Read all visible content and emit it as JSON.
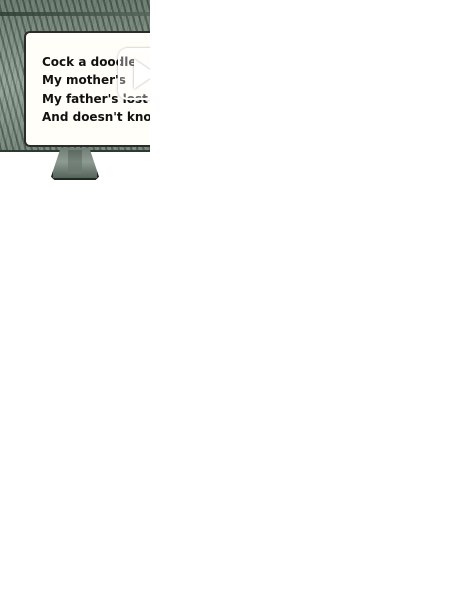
{
  "illustration": {
    "verse_lines": [
      "Cock a doodle",
      "My mother's",
      "My father's lost",
      "And doesn't know"
    ]
  },
  "player": {
    "play_icon_name": "play-icon"
  }
}
